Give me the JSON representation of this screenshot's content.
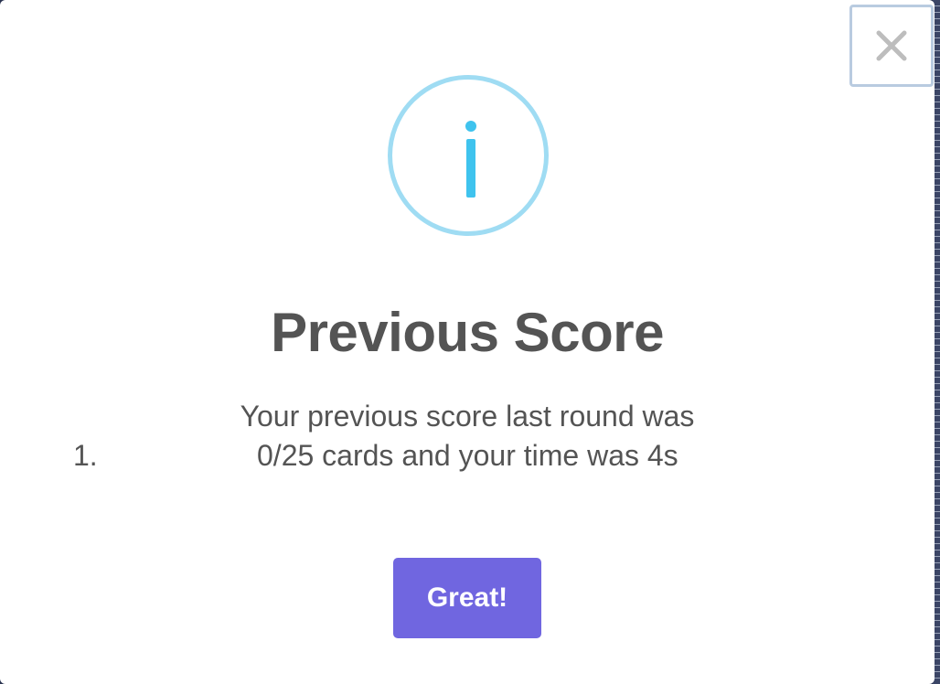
{
  "dialog": {
    "title": "Previous Score",
    "message_line1": "Your previous score last round was",
    "list_marker": "1.",
    "message_line2": "0/25 cards and your time was 4s",
    "confirm_label": "Great!",
    "close_label": "×",
    "icon": "info-icon",
    "colors": {
      "icon_ring": "#9fdcf3",
      "icon_glyph": "#3fc3ee",
      "confirm_button": "#7066e0",
      "text": "#545454"
    }
  }
}
